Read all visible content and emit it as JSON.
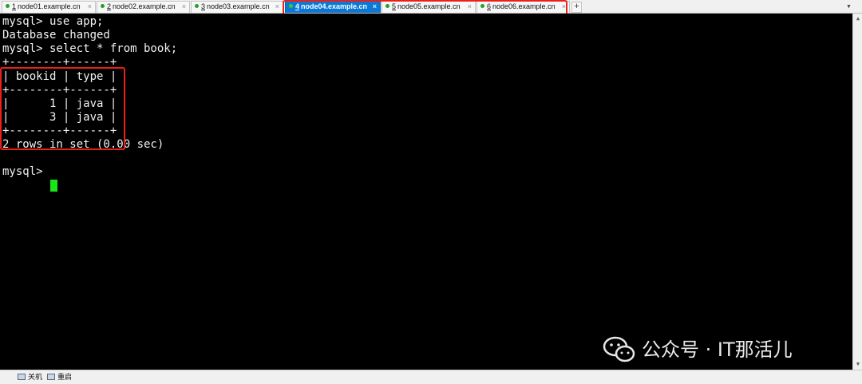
{
  "tabs": [
    {
      "num": "1",
      "label": "node01.example.cn",
      "active": false
    },
    {
      "num": "2",
      "label": "node02.example.cn",
      "active": false
    },
    {
      "num": "3",
      "label": "node03.example.cn",
      "active": false
    },
    {
      "num": "4",
      "label": "node04.example.cn",
      "active": true
    },
    {
      "num": "5",
      "label": "node05.example.cn",
      "active": false
    },
    {
      "num": "6",
      "label": "node06.example.cn",
      "active": false
    }
  ],
  "tab_close_glyph": "×",
  "add_tab_glyph": "+",
  "tab_menu_glyph": "▼",
  "colors": {
    "highlight_box": "#e8221b",
    "active_tab": "#0a78d4",
    "cursor": "#19e619",
    "session_dot": "#1fa22a"
  },
  "terminal": {
    "lines": [
      "mysql> use app;",
      "Database changed",
      "mysql> select * from book;",
      "+--------+------+",
      "| bookid | type |",
      "+--------+------+",
      "|      1 | java |",
      "|      3 | java |",
      "+--------+------+",
      "2 rows in set (0.00 sec)",
      "",
      "mysql> "
    ],
    "result_table": {
      "columns": [
        "bookid",
        "type"
      ],
      "rows": [
        [
          "1",
          "java"
        ],
        [
          "3",
          "java"
        ]
      ],
      "row_count_message": "2 rows in set (0.00 sec)"
    }
  },
  "statusbar": {
    "item1": "关机",
    "item2": "重启",
    "item1_icon": "power-icon",
    "item2_icon": "restart-icon"
  },
  "watermark": {
    "text": "公众号 · IT那活儿",
    "icon": "wechat-logo"
  }
}
